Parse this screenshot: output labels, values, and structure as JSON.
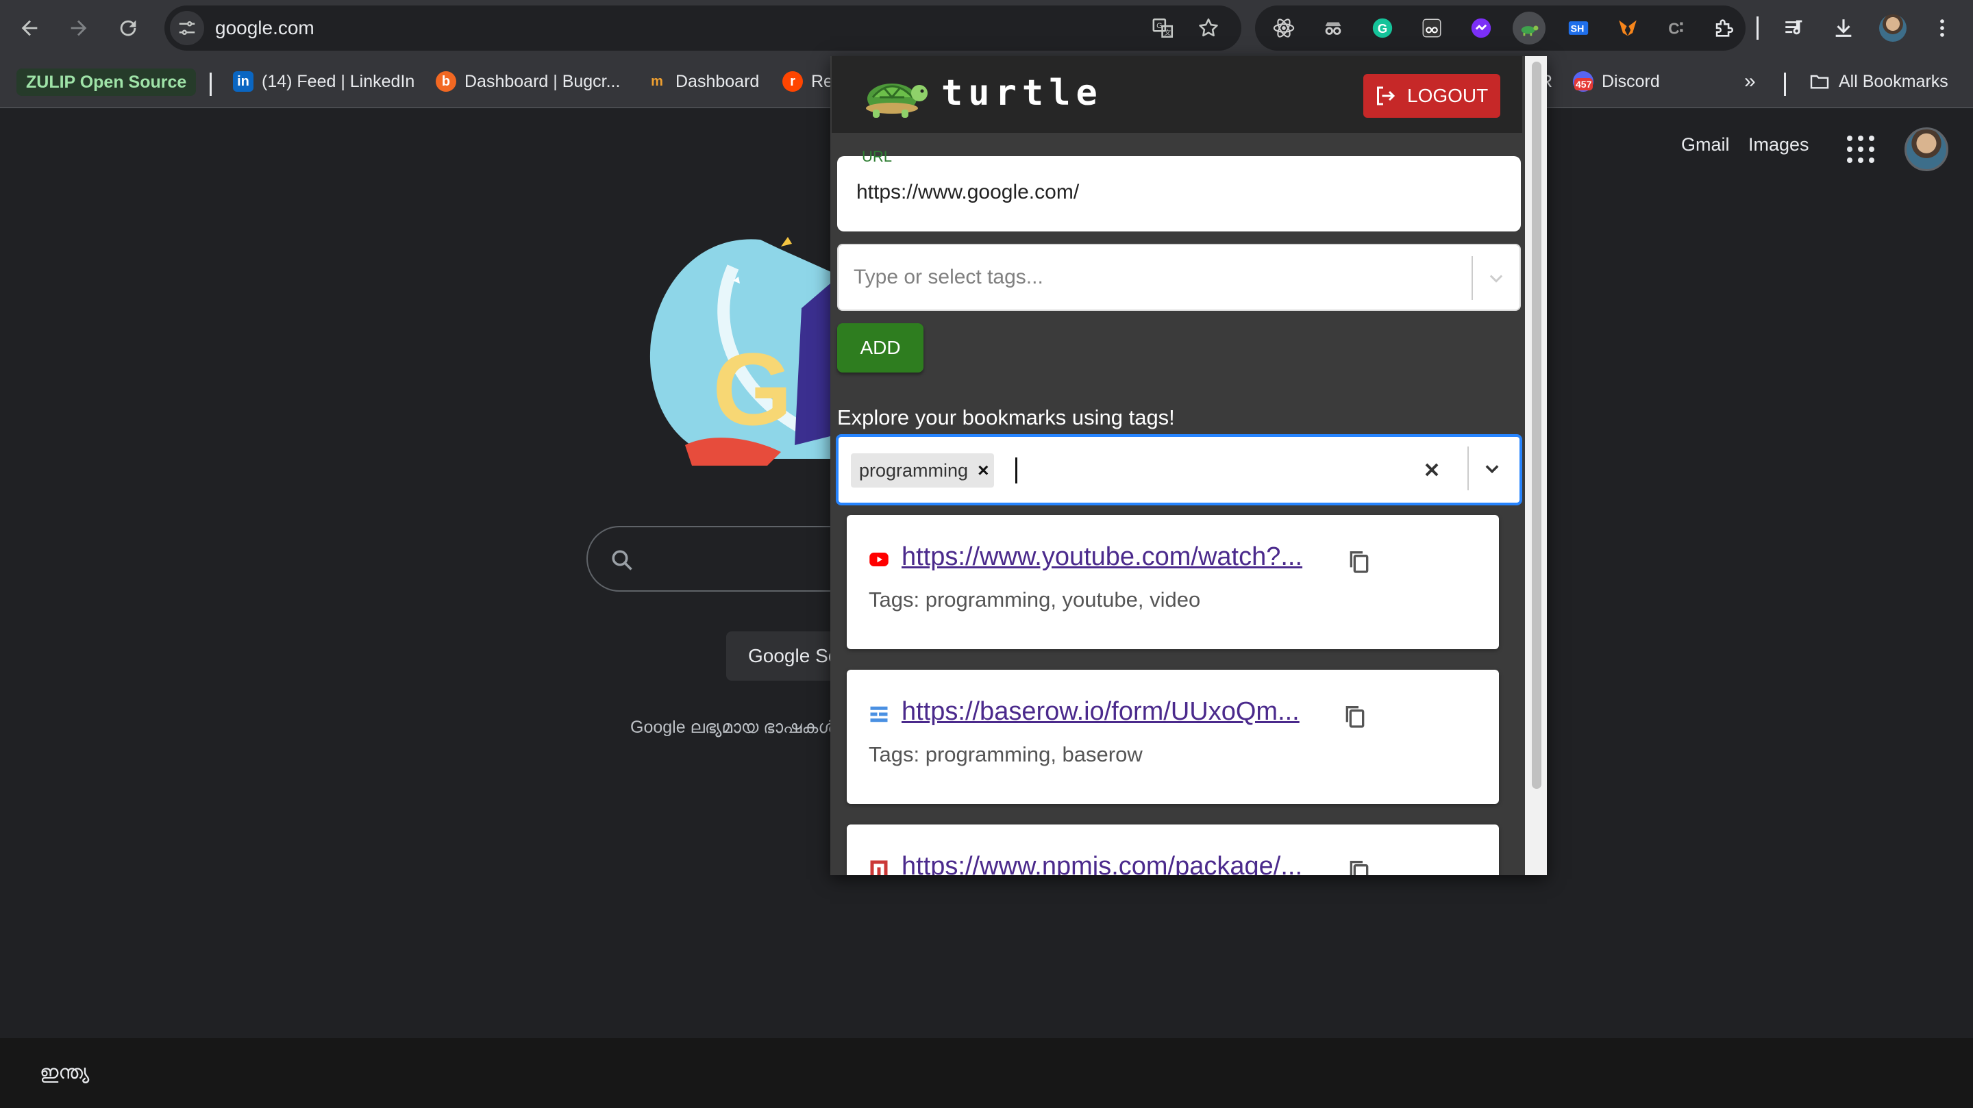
{
  "browser": {
    "url": "google.com",
    "bookmarks": [
      {
        "label": "ZULIP Open Source"
      },
      {
        "label": "(14) Feed | LinkedIn"
      },
      {
        "label": "Dashboard | Bugcr..."
      },
      {
        "label": "Dashboard"
      },
      {
        "label": "Re"
      },
      {
        "label": "R"
      },
      {
        "label": "Discord"
      },
      {
        "label": "All Bookmarks"
      }
    ],
    "discord_badge": "457"
  },
  "google": {
    "gmail": "Gmail",
    "images": "Images",
    "search_button": "Google Se",
    "language_line": "Google ലഭ്യമായ ഭാഷകൾ",
    "footer_country": "ഇന്ത്യ"
  },
  "extension": {
    "title": "turtle",
    "logout_label": "LOGOUT",
    "url_label": "URL",
    "url_value": "https://www.google.com/",
    "tags_placeholder": "Type or select tags...",
    "add_label": "ADD",
    "explore_text": "Explore your bookmarks using tags!",
    "selected_tag": "programming",
    "results": [
      {
        "url": "https://www.youtube.com/watch?...",
        "tags": "Tags: programming, youtube, video",
        "favicon": "youtube-icon"
      },
      {
        "url": "https://baserow.io/form/UUxoQm...",
        "tags": "Tags: programming, baserow",
        "favicon": "baserow-icon"
      },
      {
        "url": "https://www.npmjs.com/package/...",
        "tags": "",
        "favicon": "npm-icon"
      }
    ]
  },
  "colors": {
    "chrome_bg": "#35363a",
    "page_bg": "#202124",
    "popup_bg": "#3b3b3b",
    "logout_red": "#c62828",
    "add_green": "#2e7d1f",
    "focus_blue": "#2684ff",
    "link_purple": "#4b2a8c"
  }
}
